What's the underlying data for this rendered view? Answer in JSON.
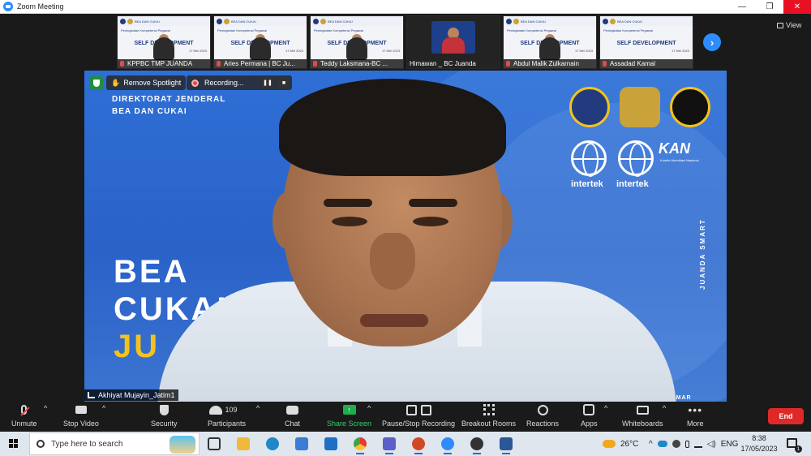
{
  "window": {
    "title": "Zoom Meeting",
    "minimize_glyph": "—",
    "restore_glyph": "❐",
    "close_glyph": "✕"
  },
  "top_right": {
    "view_label": "View"
  },
  "thumbnails": [
    {
      "name": "KPPBC TMP JUANDA",
      "slide_title": "SELF DEVELOPMENT"
    },
    {
      "name": "Aries Permana | BC Ju...",
      "slide_title": "SELF DEVELOPMENT"
    },
    {
      "name": "Teddy Laksmana-BC ...",
      "slide_title": "SELF DEVELOPMENT"
    },
    {
      "name": "Himawan _ BC Juanda",
      "slide_title": ""
    },
    {
      "name": "Abdul Malik Zulkarnain",
      "slide_title": "SELF DEVELOPMENT"
    },
    {
      "name": "Assadad Kamal",
      "slide_title": "SELF DEVELOPMENT"
    }
  ],
  "thumbnail_meta": {
    "header_text": "BEA DAN CUKAI",
    "subtitle": "Peningkatan Kompetensi Pegawai",
    "date": "17 Mei 2023"
  },
  "spotlight": {
    "remove_spotlight_label": "Remove Spotlight",
    "recording_label": "Recording...",
    "speaker_name": "Akhiyat Mujayin_Jatim1"
  },
  "background": {
    "org_line1": "DIREKTORAT JENDERAL",
    "org_line2": "BEA DAN CUKAI",
    "big_line1": "BEA",
    "big_line2": "CUKAI",
    "big_line3": "JU",
    "vertical_text": "JUANDA SMART",
    "intertek_1": "intertek",
    "intertek_2": "intertek",
    "kan_logo": "KAN",
    "kan_sub": "Komite Akreditasi Nasional",
    "bottom_mark": "SMAR"
  },
  "controls": {
    "unmute": "Unmute",
    "stop_video": "Stop Video",
    "security": "Security",
    "participants": "Participants",
    "participants_count": "109",
    "chat": "Chat",
    "share_screen": "Share Screen",
    "pause_recording": "Pause/Stop Recording",
    "breakout": "Breakout Rooms",
    "reactions": "Reactions",
    "apps": "Apps",
    "whiteboards": "Whiteboards",
    "more": "More",
    "end": "End"
  },
  "taskbar": {
    "search_placeholder": "Type here to search",
    "temperature": "26°C",
    "language": "ENG",
    "time": "8:38",
    "date": "17/05/2023",
    "notification_count": "1"
  },
  "colors": {
    "zoom_blue": "#2d8cff",
    "end_red": "#e02828",
    "share_green": "#1fae4d",
    "slide_blue": "#2e6fd6"
  }
}
